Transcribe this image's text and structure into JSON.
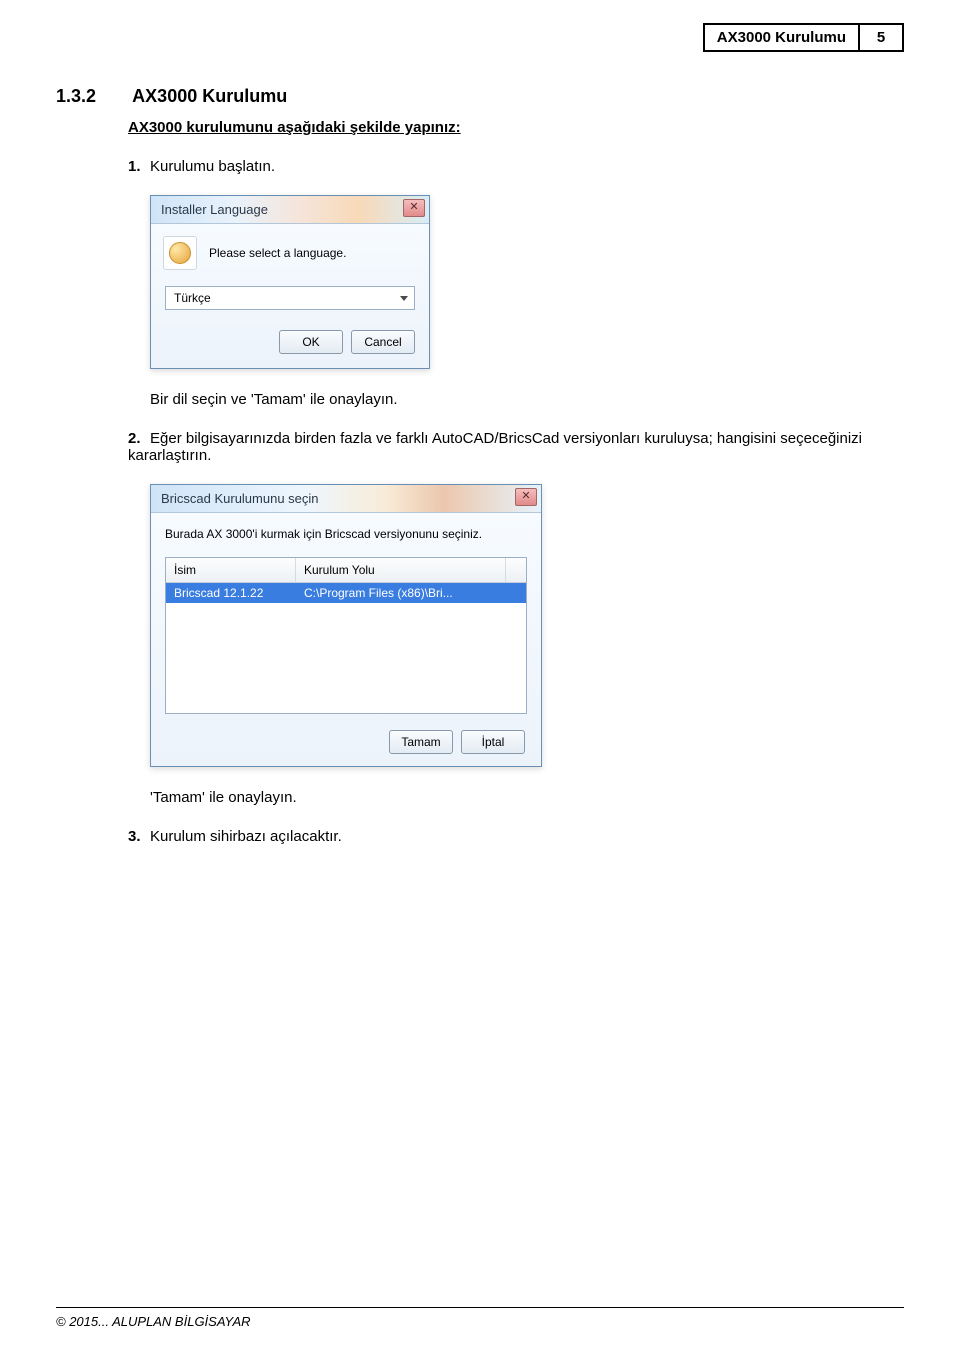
{
  "header": {
    "title": "AX3000 Kurulumu",
    "page_number": "5"
  },
  "section": {
    "number": "1.3.2",
    "title": "AX3000 Kurulumu",
    "subtitle": "AX3000 kurulumunu aşağıdaki şekilde yapınız:"
  },
  "steps": {
    "s1_num": "1.",
    "s1_text": "Kurulumu başlatın.",
    "s1_after": "Bir dil seçin ve 'Tamam' ile onaylayın.",
    "s2_num": "2.",
    "s2_text": "Eğer bilgisayarınızda birden fazla ve farklı AutoCAD/BricsCad versiyonları kuruluysa; hangisini seçeceğinizi  kararlaştırın.",
    "s2_after": "'Tamam' ile onaylayın.",
    "s3_num": "3.",
    "s3_text": "Kurulum sihirbazı açılacaktır."
  },
  "dialog1": {
    "title": "Installer Language",
    "prompt": "Please select a language.",
    "selected": "Türkçe",
    "ok": "OK",
    "cancel": "Cancel",
    "close": "✕"
  },
  "dialog2": {
    "title": "Bricscad Kurulumunu seçin",
    "instruction": "Burada AX 3000'i kurmak için Bricscad versiyonunu seçiniz.",
    "col1": "İsim",
    "col2": "Kurulum Yolu",
    "row_name": "Bricscad 12.1.22",
    "row_path": "C:\\Program Files (x86)\\Bri...",
    "ok": "Tamam",
    "cancel": "İptal",
    "close": "✕"
  },
  "footer": {
    "copyright": "© 2015... ALUPLAN BİLGİSAYAR"
  }
}
